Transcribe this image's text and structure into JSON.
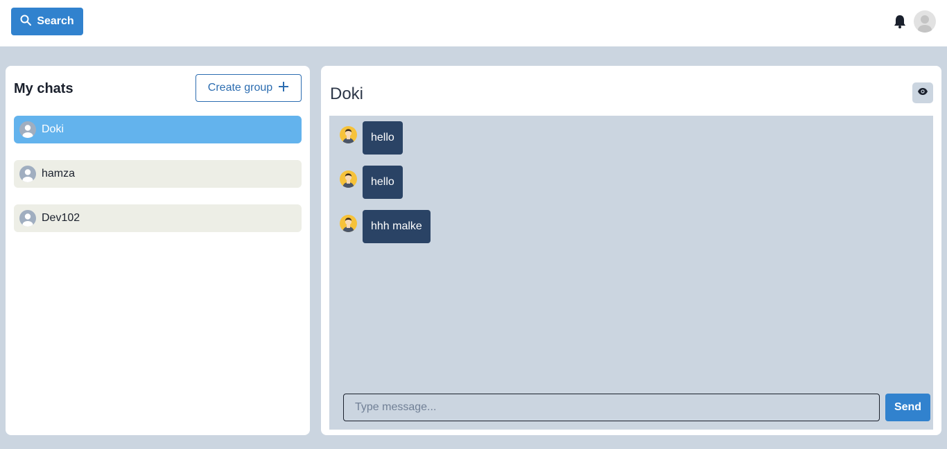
{
  "topbar": {
    "search_label": "Search",
    "search_icon": "search-icon",
    "notification_icon": "bell-icon",
    "user_icon": "avatar"
  },
  "sidebar": {
    "title": "My chats",
    "create_group_label": "Create group",
    "create_group_icon": "plus-icon",
    "chats": [
      {
        "name": "Doki",
        "active": true
      },
      {
        "name": "hamza",
        "active": false
      },
      {
        "name": "Dev102",
        "active": false
      }
    ]
  },
  "chat": {
    "title": "Doki",
    "view_icon": "eye-icon",
    "messages": [
      {
        "text": "hello"
      },
      {
        "text": "hello"
      },
      {
        "text": "hhh malke"
      }
    ],
    "input_placeholder": "Type message...",
    "send_label": "Send"
  },
  "colors": {
    "page_bg": "#cbd5e0",
    "primary": "#3182ce",
    "active_chat": "#63b3ed",
    "inactive_chat": "#edeee6",
    "bubble": "#2a4365"
  }
}
